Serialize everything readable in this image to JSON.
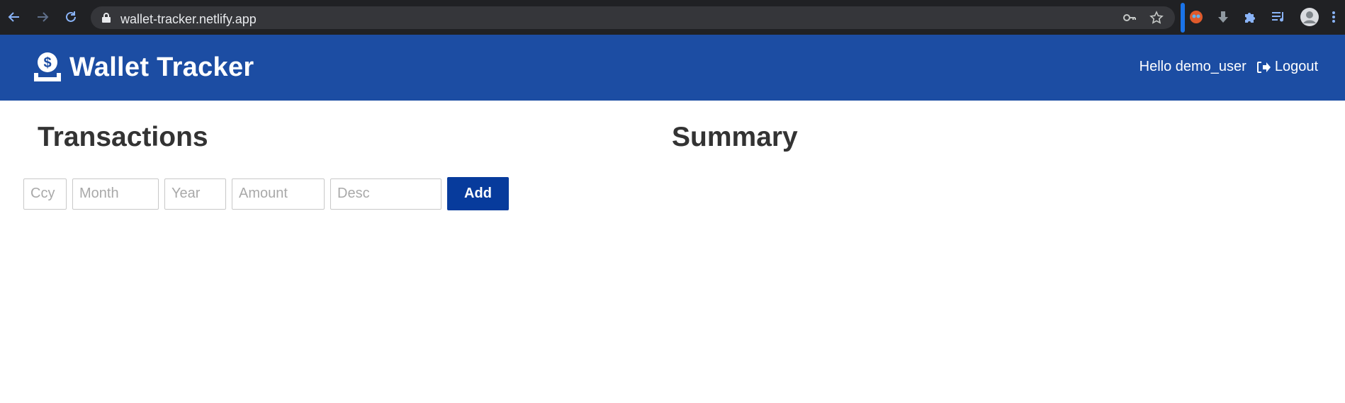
{
  "browser": {
    "url": "wallet-tracker.netlify.app",
    "icons": [
      "back-arrow-icon",
      "forward-arrow-icon",
      "reload-icon",
      "lock-icon",
      "key-icon",
      "star-icon",
      "extension-avatar-icon",
      "download-arrow-icon",
      "puzzle-icon",
      "media-queue-icon",
      "profile-avatar-icon",
      "kebab-menu-icon"
    ],
    "accent": "#1a73e8"
  },
  "header": {
    "title": "Wallet Tracker",
    "greeting": "Hello demo_user",
    "logout_label": "Logout",
    "background": "#1c4da3"
  },
  "transactions": {
    "title": "Transactions",
    "form": {
      "ccy_placeholder": "Ccy",
      "month_placeholder": "Month",
      "year_placeholder": "Year",
      "amount_placeholder": "Amount",
      "desc_placeholder": "Desc",
      "add_label": "Add",
      "add_color": "#073b9c"
    }
  },
  "summary": {
    "title": "Summary"
  }
}
